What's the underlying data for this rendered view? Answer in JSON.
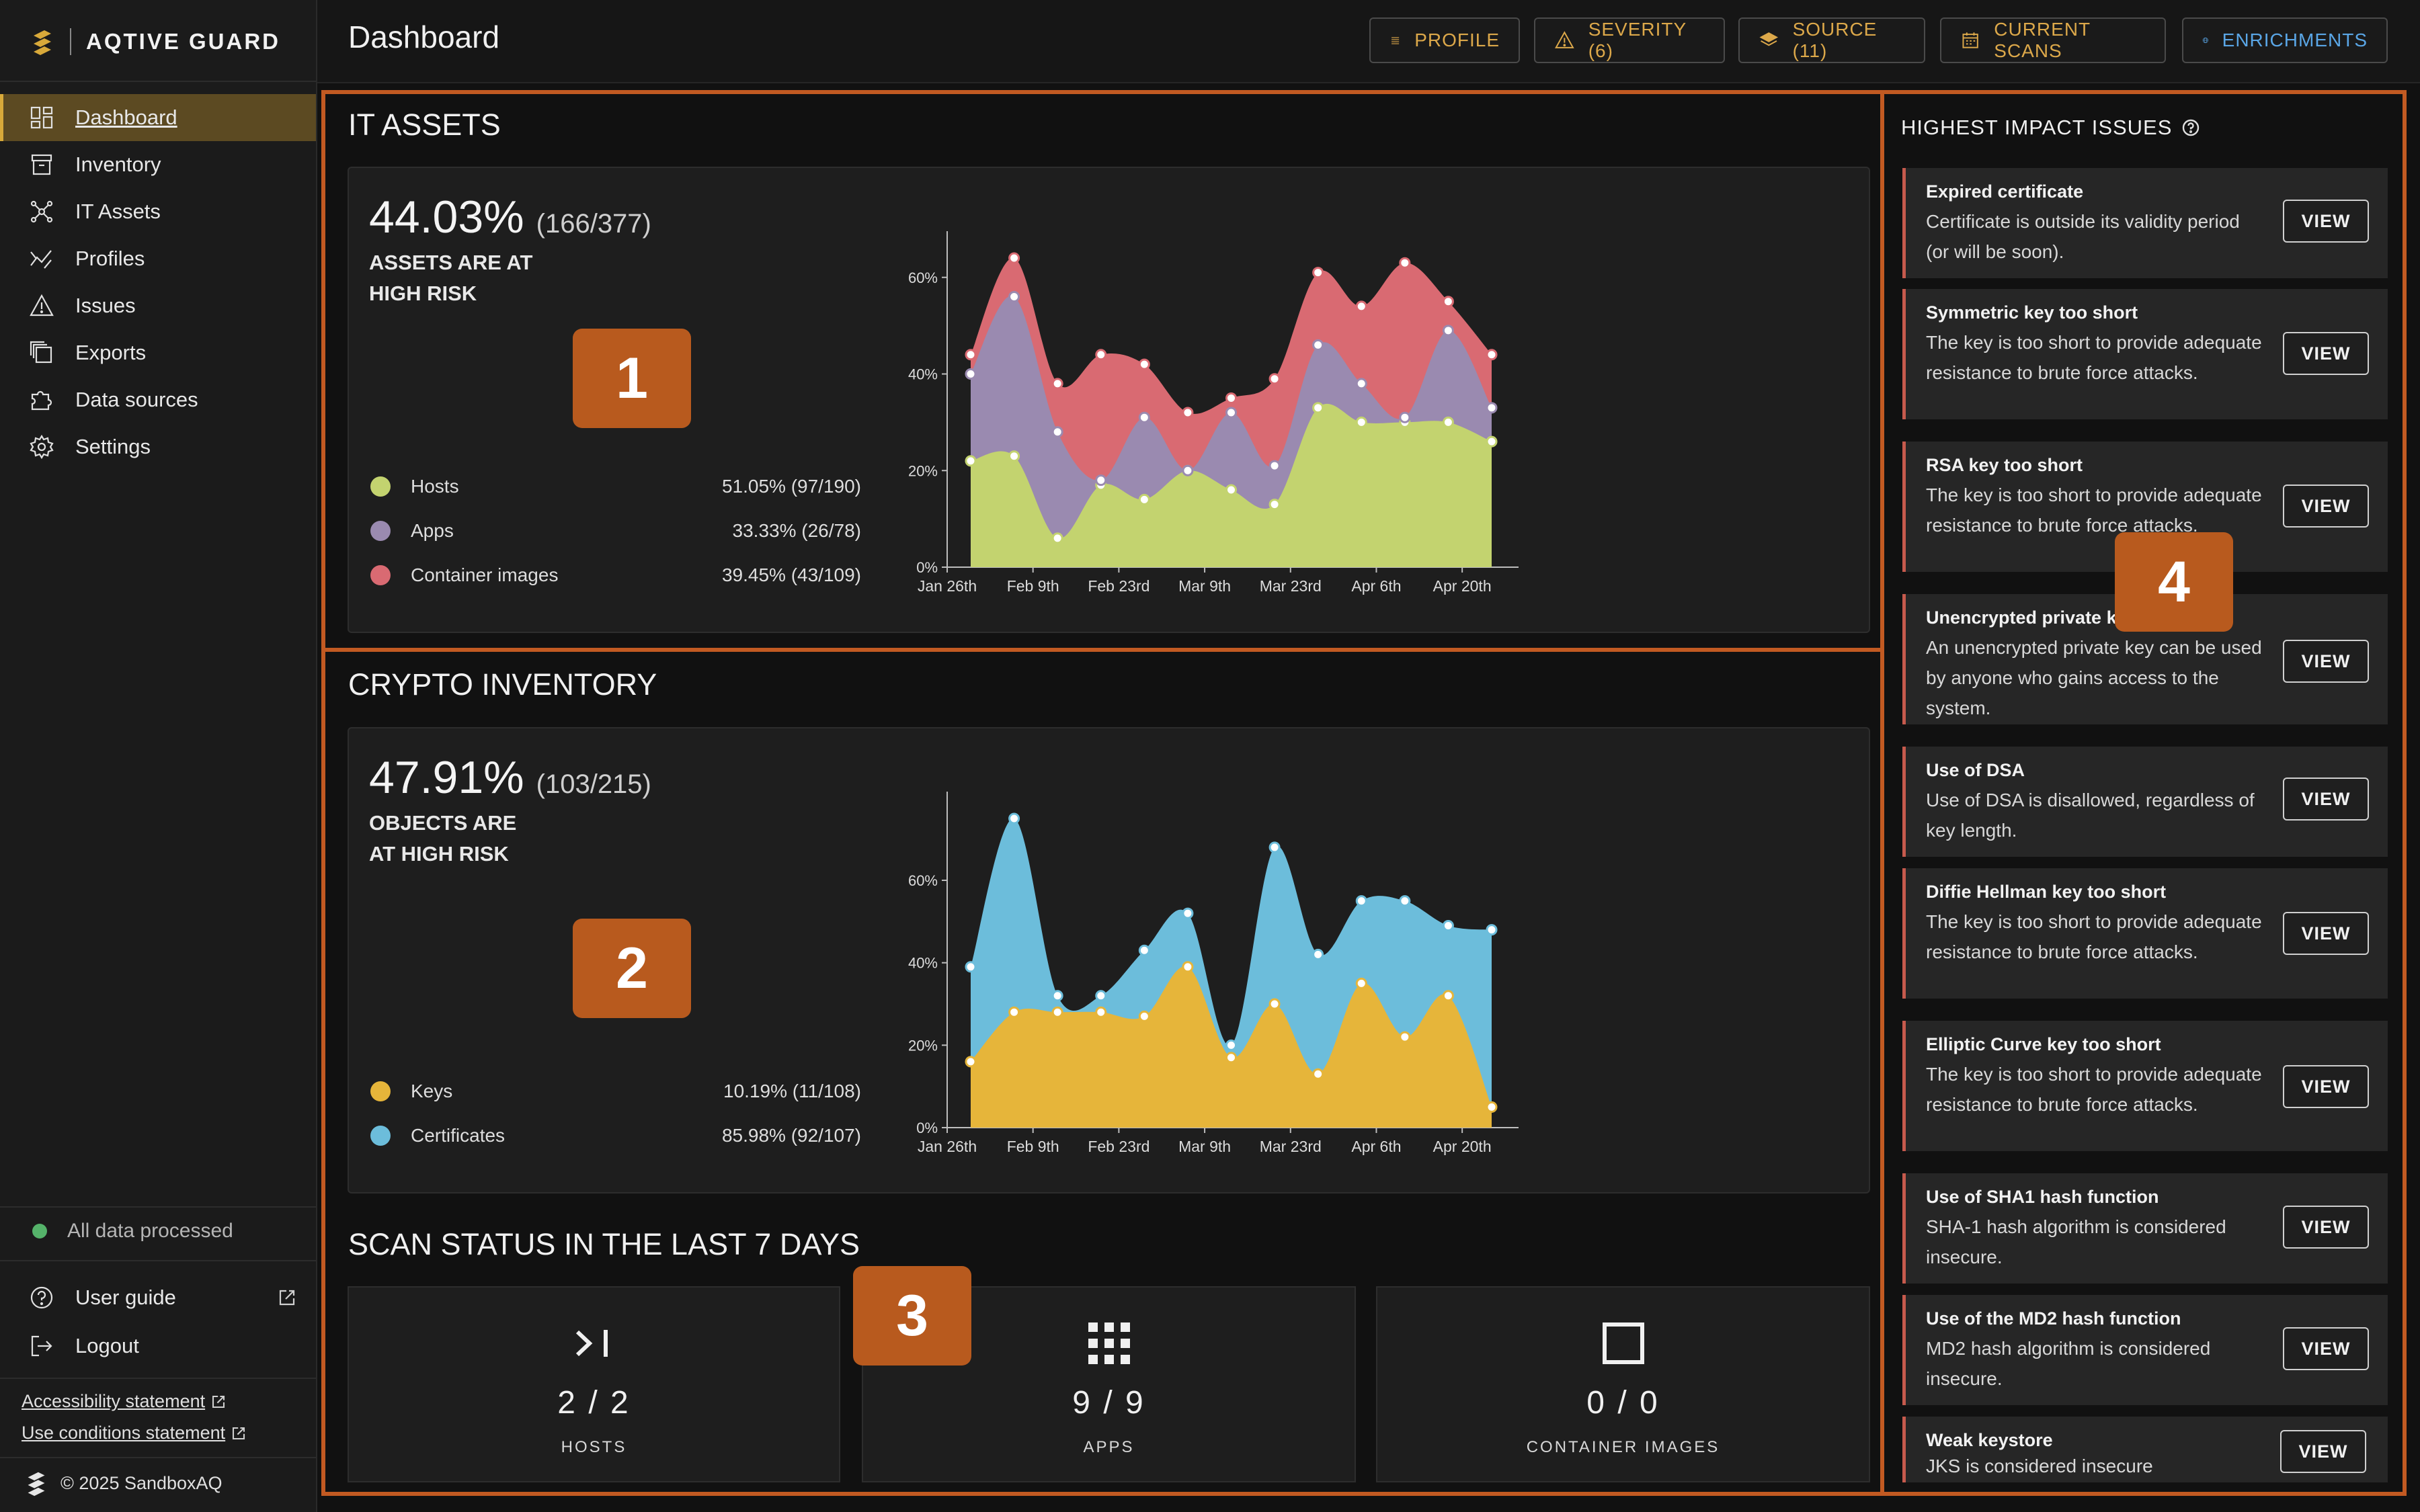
{
  "brand": {
    "name": "AQTIVE GUARD"
  },
  "sidebar": {
    "items": [
      {
        "label": "Dashboard",
        "icon": "dashboard-icon",
        "active": true
      },
      {
        "label": "Inventory",
        "icon": "inventory-icon"
      },
      {
        "label": "IT Assets",
        "icon": "network-icon"
      },
      {
        "label": "Profiles",
        "icon": "profiles-icon"
      },
      {
        "label": "Issues",
        "icon": "warning-icon"
      },
      {
        "label": "Exports",
        "icon": "exports-icon"
      },
      {
        "label": "Data sources",
        "icon": "puzzle-icon"
      },
      {
        "label": "Settings",
        "icon": "gear-icon"
      }
    ],
    "status": "All data processed",
    "user_guide": "User guide",
    "logout": "Logout",
    "accessibility": "Accessibility statement",
    "use_conditions": "Use conditions statement",
    "copyright": "© 2025 SandboxAQ"
  },
  "header": {
    "title": "Dashboard",
    "buttons": [
      {
        "label": "PROFILE",
        "icon": "list-icon"
      },
      {
        "label": "SEVERITY (6)",
        "icon": "warning-icon"
      },
      {
        "label": "SOURCE (11)",
        "icon": "layers-icon"
      },
      {
        "label": "CURRENT SCANS",
        "icon": "calendar-icon"
      },
      {
        "label": "ENRICHMENTS",
        "icon": "globe-icon"
      }
    ]
  },
  "colors": {
    "accent": "#d8a93a",
    "outline": "#c25a22",
    "hosts": "#c3d36f",
    "apps": "#9a8ab0",
    "containers": "#d96a72",
    "keys": "#e6b53a",
    "certificates": "#6cbddb"
  },
  "it_assets": {
    "title": "IT ASSETS",
    "percent": "44.03%",
    "ratio": "(166/377)",
    "label": "ASSETS ARE AT HIGH RISK",
    "badge": "1",
    "legend": [
      {
        "name": "Hosts",
        "value": "51.05%  (97/190)"
      },
      {
        "name": "Apps",
        "value": "33.33%  (26/78)"
      },
      {
        "name": "Container images",
        "value": "39.45%  (43/109)"
      }
    ]
  },
  "crypto_inventory": {
    "title": "CRYPTO INVENTORY",
    "percent": "47.91%",
    "ratio": "(103/215)",
    "label": "OBJECTS ARE AT HIGH RISK",
    "badge": "2",
    "legend": [
      {
        "name": "Keys",
        "value": "10.19%  (11/108)"
      },
      {
        "name": "Certificates",
        "value": "85.98%  (92/107)"
      }
    ]
  },
  "scan_status": {
    "title": "SCAN STATUS IN THE LAST 7 DAYS",
    "badge": "3",
    "tiles": [
      {
        "count": "2 / 2",
        "label": "HOSTS",
        "icon": "terminal-icon"
      },
      {
        "count": "9 / 9",
        "label": "APPS",
        "icon": "grid-icon"
      },
      {
        "count": "0 / 0",
        "label": "CONTAINER IMAGES",
        "icon": "square-icon"
      }
    ]
  },
  "issues": {
    "title": "HIGHEST IMPACT ISSUES",
    "badge": "4",
    "view_label": "VIEW",
    "items": [
      {
        "title": "Expired certificate",
        "desc": "Certificate is outside its validity period (or will be soon)."
      },
      {
        "title": "Symmetric key too short",
        "desc": "The key is too short to provide adequate resistance to brute force attacks."
      },
      {
        "title": "RSA key too short",
        "desc": "The key is too short to provide adequate resistance to brute force attacks."
      },
      {
        "title": "Unencrypted private key",
        "desc": "An unencrypted private key can be used by anyone who gains access to the system."
      },
      {
        "title": "Use of DSA",
        "desc": "Use of DSA is disallowed, regardless of key length."
      },
      {
        "title": "Diffie Hellman key too short",
        "desc": "The key is too short to provide adequate resistance to brute force attacks."
      },
      {
        "title": "Elliptic Curve key too short",
        "desc": "The key is too short to provide adequate resistance to brute force attacks."
      },
      {
        "title": "Use of SHA1 hash function",
        "desc": "SHA-1 hash algorithm is considered insecure."
      },
      {
        "title": "Use of the MD2 hash function",
        "desc": "MD2 hash algorithm is considered insecure."
      },
      {
        "title": "Weak keystore",
        "desc": "JKS is considered insecure"
      }
    ]
  },
  "chart_data": [
    {
      "type": "area",
      "stacked": true,
      "x_ticks": [
        "Jan 26th",
        "Feb 9th",
        "Feb 23rd",
        "Mar 9th",
        "Mar 23rd",
        "Apr 6th",
        "Apr 20th"
      ],
      "y_ticks": [
        "0%",
        "20%",
        "40%",
        "60%"
      ],
      "ylim": [
        0,
        64
      ],
      "x": [
        0,
        1,
        2,
        3,
        4,
        5,
        6,
        7,
        8,
        9,
        10,
        11,
        12
      ],
      "series": [
        {
          "name": "Hosts",
          "values": [
            22,
            23,
            6,
            17,
            14,
            20,
            16,
            13,
            33,
            30,
            30,
            30,
            26
          ]
        },
        {
          "name": "Apps",
          "values": [
            40,
            56,
            28,
            18,
            31,
            20,
            32,
            21,
            46,
            38,
            31,
            49,
            33
          ]
        },
        {
          "name": "Container images",
          "values": [
            44,
            64,
            38,
            44,
            42,
            32,
            35,
            39,
            61,
            54,
            63,
            55,
            44
          ]
        }
      ]
    },
    {
      "type": "area",
      "stacked": true,
      "x_ticks": [
        "Jan 26th",
        "Feb 9th",
        "Feb 23rd",
        "Mar 9th",
        "Mar 23rd",
        "Apr 6th",
        "Apr 20th"
      ],
      "y_ticks": [
        "0%",
        "20%",
        "40%",
        "60%"
      ],
      "ylim": [
        0,
        75
      ],
      "x": [
        0,
        1,
        2,
        3,
        4,
        5,
        6,
        7,
        8,
        9,
        10,
        11,
        12
      ],
      "series": [
        {
          "name": "Keys",
          "values": [
            16,
            28,
            28,
            28,
            27,
            39,
            17,
            30,
            13,
            35,
            22,
            32,
            5
          ]
        },
        {
          "name": "Certificates",
          "values": [
            39,
            75,
            32,
            32,
            43,
            52,
            20,
            68,
            42,
            55,
            55,
            49,
            48
          ]
        }
      ]
    }
  ]
}
